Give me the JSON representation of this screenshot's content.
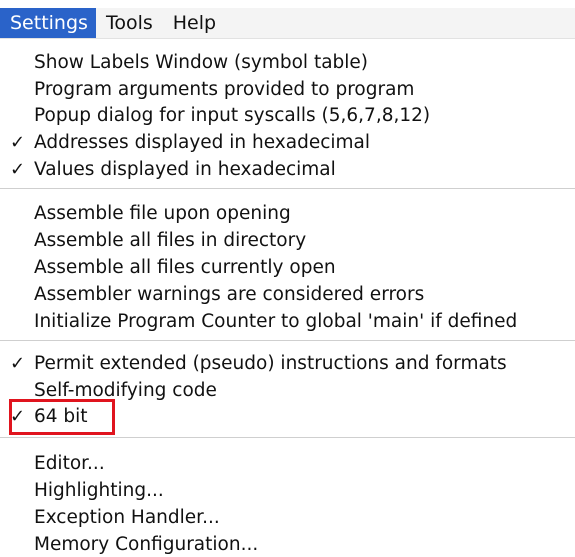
{
  "menubar": {
    "menus": [
      "Settings",
      "Tools",
      "Help"
    ]
  },
  "settings_menu": {
    "group1": [
      {
        "label": "Show Labels Window (symbol table)",
        "checked": false
      },
      {
        "label": "Program arguments provided to program",
        "checked": false
      },
      {
        "label": "Popup dialog for input syscalls (5,6,7,8,12)",
        "checked": false
      },
      {
        "label": "Addresses displayed in hexadecimal",
        "checked": true
      },
      {
        "label": "Values displayed in hexadecimal",
        "checked": true
      }
    ],
    "group2": [
      {
        "label": "Assemble file upon opening",
        "checked": false
      },
      {
        "label": "Assemble all files in directory",
        "checked": false
      },
      {
        "label": "Assemble all files currently open",
        "checked": false
      },
      {
        "label": "Assembler warnings are considered errors",
        "checked": false
      },
      {
        "label": "Initialize Program Counter to global 'main' if defined",
        "checked": false
      }
    ],
    "group3": [
      {
        "label": "Permit extended (pseudo) instructions and formats",
        "checked": true
      },
      {
        "label": "Self-modifying code",
        "checked": false
      },
      {
        "label": "64 bit",
        "checked": true
      }
    ],
    "group4": [
      {
        "label": "Editor...",
        "checked": false
      },
      {
        "label": "Highlighting...",
        "checked": false
      },
      {
        "label": "Exception Handler...",
        "checked": false
      },
      {
        "label": "Memory Configuration...",
        "checked": false
      }
    ],
    "check_glyph": "✓"
  },
  "colors": {
    "menu_active_bg": "#2a63c9",
    "highlight_border": "#e0141e"
  }
}
